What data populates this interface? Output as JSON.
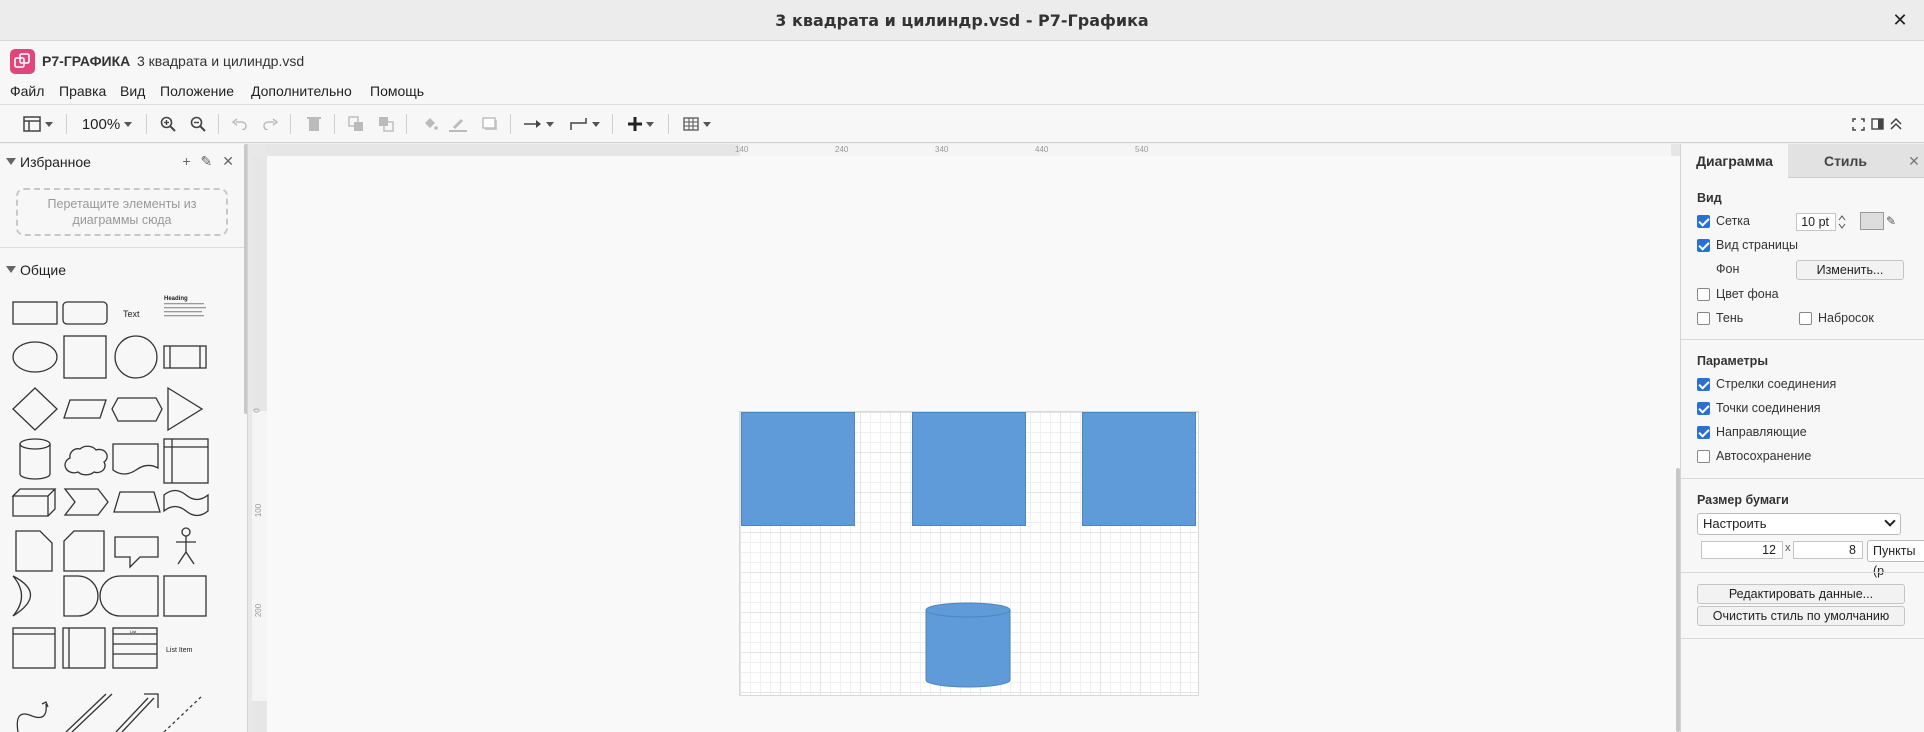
{
  "window": {
    "title": "3 квадрата и цилиндр.vsd - Р7-Графика"
  },
  "app": {
    "name": "Р7-ГРАФИКА",
    "filename": "3 квадрата и цилиндр.vsd"
  },
  "menu": [
    "Файл",
    "Правка",
    "Вид",
    "Положение",
    "Дополнительно",
    "Помощь"
  ],
  "toolbar": {
    "zoom": "100%"
  },
  "left_panel": {
    "favorites_label": "Избранное",
    "dropzone_text": "Перетащите элементы из диаграммы сюда",
    "general_label": "Общие",
    "shape_text": "Text",
    "shape_heading": "Heading",
    "shape_list_item": "List Item",
    "shape_list": "List"
  },
  "rulers": {
    "h": [
      "140",
      "240",
      "340",
      "440",
      "540"
    ],
    "v": [
      "0",
      "100",
      "200"
    ]
  },
  "right_panel": {
    "tab_diagram": "Диаграмма",
    "tab_style": "Стиль",
    "view_section": "Вид",
    "grid_label": "Сетка",
    "grid_size": "10 pt",
    "page_view_label": "Вид страницы",
    "background_label": "Фон",
    "change_button": "Изменить...",
    "bg_color_label": "Цвет фона",
    "shadow_label": "Тень",
    "sketch_label": "Набросок",
    "params_section": "Параметры",
    "connection_arrows": "Стрелки соединения",
    "connection_points": "Точки соединения",
    "guides": "Направляющие",
    "autosave": "Автосохранение",
    "paper_size_section": "Размер бумаги",
    "paper_select": "Настроить",
    "paper_width": "12",
    "paper_x": "x",
    "paper_height": "8",
    "units_select": "Пункты (р",
    "edit_data_button": "Редактировать данные...",
    "clear_style_button": "Очистить стиль по умолчанию"
  },
  "colors": {
    "shape_fill": "#5e9bd8",
    "checkbox_accent": "#2a6fd6",
    "logo": "#e0457b"
  }
}
